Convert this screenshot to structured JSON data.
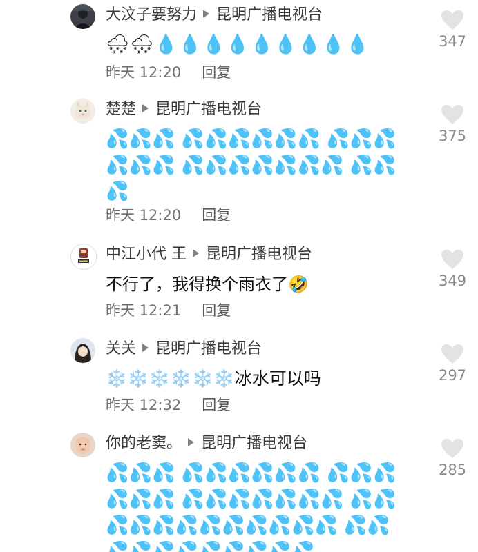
{
  "comments": [
    {
      "author": "大汶子要努力",
      "target": "昆明广播电视台",
      "content": "🌨🌨💧💧💧💧💧💧💧💧💧",
      "time": "昨天 12:20",
      "reply": "回复",
      "likes": "347",
      "avatar_icon": "dark-portrait-avatar-icon"
    },
    {
      "author": "楚楚",
      "target": "昆明广播电视台",
      "content": "💦💦💦 💦💦💦💦💦💦 💦💦💦💦💦💦 💦💦💦💦💦💦💦 💦💦💦",
      "time": "昨天 12:20",
      "reply": "回复",
      "likes": "375",
      "avatar_icon": "cat-avatar-icon"
    },
    {
      "author": "中江小代 王",
      "target": "昆明广播电视台",
      "content": "不行了，我得换个雨衣了🤣",
      "time": "昨天 12:21",
      "reply": "回复",
      "likes": "349",
      "avatar_icon": "logo-avatar-icon"
    },
    {
      "author": "关关",
      "target": "昆明广播电视台",
      "content": "❄️❄️❄️❄️❄️❄️冰水可以吗",
      "time": "昨天 12:32",
      "reply": "回复",
      "likes": "297",
      "avatar_icon": "girl-avatar-icon"
    },
    {
      "author": "你的老窦。",
      "target": "昆明广播电视台",
      "content": "💦💦💦 💦💦💦💦💦💦 💦💦💦💦💦💦 💦💦💦💦💦💦💦 💦💦💦💦💦💦💦💦💦💦💦💦 💦💦💦💦💦💦💦💦💦💦💦",
      "time": "",
      "reply": "",
      "likes": "285",
      "avatar_icon": "baby-avatar-icon"
    }
  ],
  "colors": {
    "author_text": "#3a3a3a",
    "meta_text": "#707070",
    "like_icon": "#e3e3e3",
    "like_count": "#8a8a8a"
  }
}
